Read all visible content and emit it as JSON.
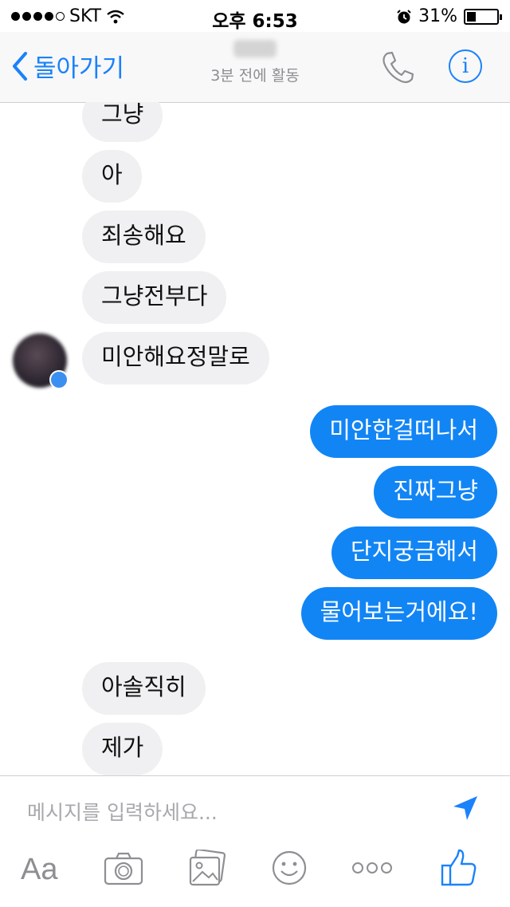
{
  "status_bar": {
    "carrier": "SKT",
    "time": "오후 6:53",
    "battery_percent": "31%",
    "battery_level": 0.31
  },
  "nav": {
    "back_label": "돌아가기",
    "subtitle": "3분 전에 활동"
  },
  "messages": [
    {
      "side": "in",
      "text": "그냥"
    },
    {
      "side": "in",
      "text": "아"
    },
    {
      "side": "in",
      "text": "죄송해요"
    },
    {
      "side": "in",
      "text": "그냥전부다"
    },
    {
      "side": "in",
      "text": "미안해요정말로"
    },
    {
      "side": "out",
      "text": "미안한걸떠나서"
    },
    {
      "side": "out",
      "text": "진짜그냥"
    },
    {
      "side": "out",
      "text": "단지궁금해서"
    },
    {
      "side": "out",
      "text": "물어보는거에요!"
    },
    {
      "side": "in",
      "text": "아솔직히"
    },
    {
      "side": "in",
      "text": "제가"
    }
  ],
  "composer": {
    "placeholder": "메시지를 입력하세요...",
    "aa_label": "Aa"
  },
  "colors": {
    "accent": "#1a82fb",
    "outgoing_bubble": "#1285f5",
    "incoming_bubble": "#f0f0f2",
    "icon_gray": "#8e8e93"
  },
  "icons": [
    "signal-icon",
    "wifi-icon",
    "alarm-icon",
    "battery-icon",
    "back-chevron-icon",
    "phone-icon",
    "info-icon",
    "send-icon",
    "camera-icon",
    "photo-icon",
    "sticker-icon",
    "more-icon",
    "like-icon"
  ]
}
